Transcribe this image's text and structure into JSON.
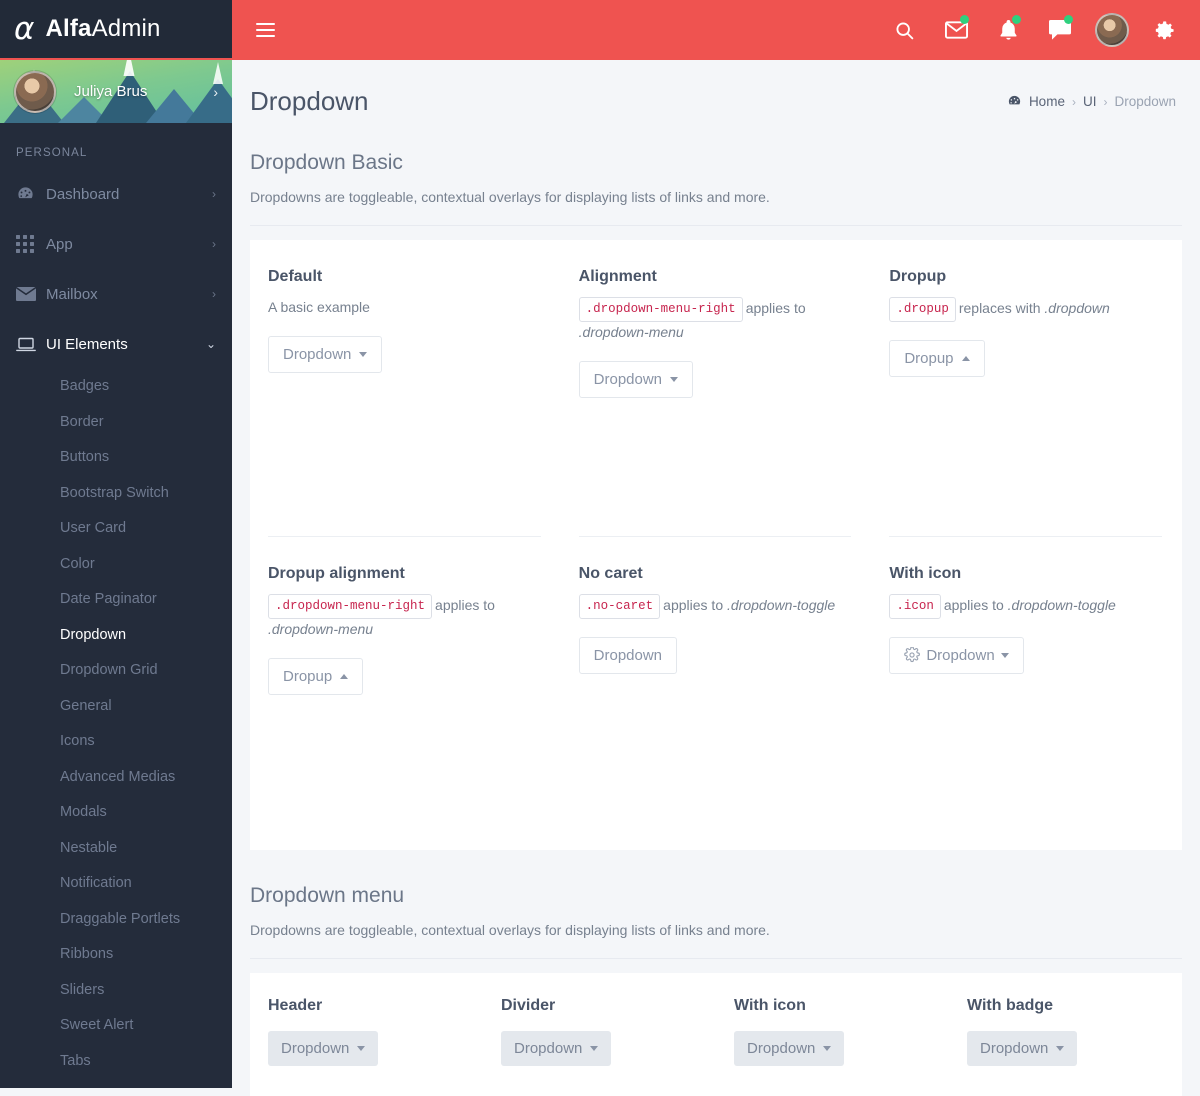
{
  "brand": {
    "logo_icon": "alpha-logo-icon",
    "name_bold": "Alfa",
    "name_light": "Admin"
  },
  "sidebar": {
    "profile": {
      "name": "Juliya Brus",
      "avatar_icon": "user-avatar",
      "chevron_icon": "chevron-right-icon"
    },
    "section_label": "PERSONAL",
    "items": [
      {
        "label": "Dashboard",
        "icon": "dashboard-icon",
        "arrow": "chevron-right-icon"
      },
      {
        "label": "App",
        "icon": "grid-apps-icon",
        "arrow": "chevron-right-icon"
      },
      {
        "label": "Mailbox",
        "icon": "envelope-icon",
        "arrow": "chevron-right-icon"
      },
      {
        "label": "UI Elements",
        "icon": "laptop-icon",
        "arrow": "chevron-down-icon",
        "expanded": true
      }
    ],
    "sub_items": [
      {
        "label": "Badges"
      },
      {
        "label": "Border"
      },
      {
        "label": "Buttons"
      },
      {
        "label": "Bootstrap Switch"
      },
      {
        "label": "User Card"
      },
      {
        "label": "Color"
      },
      {
        "label": "Date Paginator"
      },
      {
        "label": "Dropdown",
        "active": true
      },
      {
        "label": "Dropdown Grid"
      },
      {
        "label": "General"
      },
      {
        "label": "Icons"
      },
      {
        "label": "Advanced Medias"
      },
      {
        "label": "Modals"
      },
      {
        "label": "Nestable"
      },
      {
        "label": "Notification"
      },
      {
        "label": "Draggable Portlets"
      },
      {
        "label": "Ribbons"
      },
      {
        "label": "Sliders"
      },
      {
        "label": "Sweet Alert"
      },
      {
        "label": "Tabs"
      }
    ]
  },
  "topbar": {
    "menu_toggle_icon": "hamburger-icon",
    "icons": [
      {
        "name": "search-icon",
        "badge": false
      },
      {
        "name": "envelope-icon",
        "badge": true
      },
      {
        "name": "bell-icon",
        "badge": true
      },
      {
        "name": "chat-icon",
        "badge": true
      }
    ],
    "avatar_icon": "user-avatar",
    "settings_icon": "gear-icon",
    "badge_color": "#2fd07e",
    "bar_color": "#ef5350"
  },
  "page": {
    "title": "Dropdown",
    "breadcrumb": {
      "home_icon": "dashboard-icon",
      "home": "Home",
      "sep": "›",
      "level2": "UI",
      "current": "Dropdown"
    }
  },
  "basic": {
    "title": "Dropdown Basic",
    "description": "Dropdowns are toggleable, contextual overlays for displaying lists of links and more.",
    "cards": [
      {
        "title": "Default",
        "tag": "",
        "desc_before": "A basic example",
        "desc_after": "",
        "button": {
          "label": "Dropdown",
          "caret": "down",
          "icon": ""
        }
      },
      {
        "title": "Alignment",
        "tag": ".dropdown-menu-right",
        "desc_before": "applies to ",
        "desc_after": ".dropdown-menu",
        "button": {
          "label": "Dropdown",
          "caret": "down",
          "icon": ""
        }
      },
      {
        "title": "Dropup",
        "tag": ".dropup",
        "desc_before": "replaces with ",
        "desc_after": ".dropdown",
        "button": {
          "label": "Dropup",
          "caret": "up",
          "icon": ""
        }
      },
      {
        "title": "Dropup alignment",
        "tag": ".dropdown-menu-right",
        "desc_before": "applies to ",
        "desc_after": ".dropdown-menu",
        "button": {
          "label": "Dropup",
          "caret": "up",
          "icon": ""
        }
      },
      {
        "title": "No caret",
        "tag": ".no-caret",
        "desc_before": "applies to ",
        "desc_after": ".dropdown-toggle",
        "button": {
          "label": "Dropdown",
          "caret": "none",
          "icon": ""
        }
      },
      {
        "title": "With icon",
        "tag": ".icon",
        "desc_before": "applies to ",
        "desc_after": ".dropdown-toggle",
        "button": {
          "label": "Dropdown",
          "caret": "down",
          "icon": "gear-icon"
        }
      }
    ]
  },
  "menu_section": {
    "title": "Dropdown menu",
    "description": "Dropdowns are toggleable, contextual overlays for displaying lists of links and more.",
    "cards": [
      {
        "title": "Header",
        "button": {
          "label": "Dropdown",
          "caret": "down"
        }
      },
      {
        "title": "Divider",
        "button": {
          "label": "Dropdown",
          "caret": "down"
        }
      },
      {
        "title": "With icon",
        "button": {
          "label": "Dropdown",
          "caret": "down"
        }
      },
      {
        "title": "With badge",
        "button": {
          "label": "Dropdown",
          "caret": "down"
        }
      }
    ]
  }
}
